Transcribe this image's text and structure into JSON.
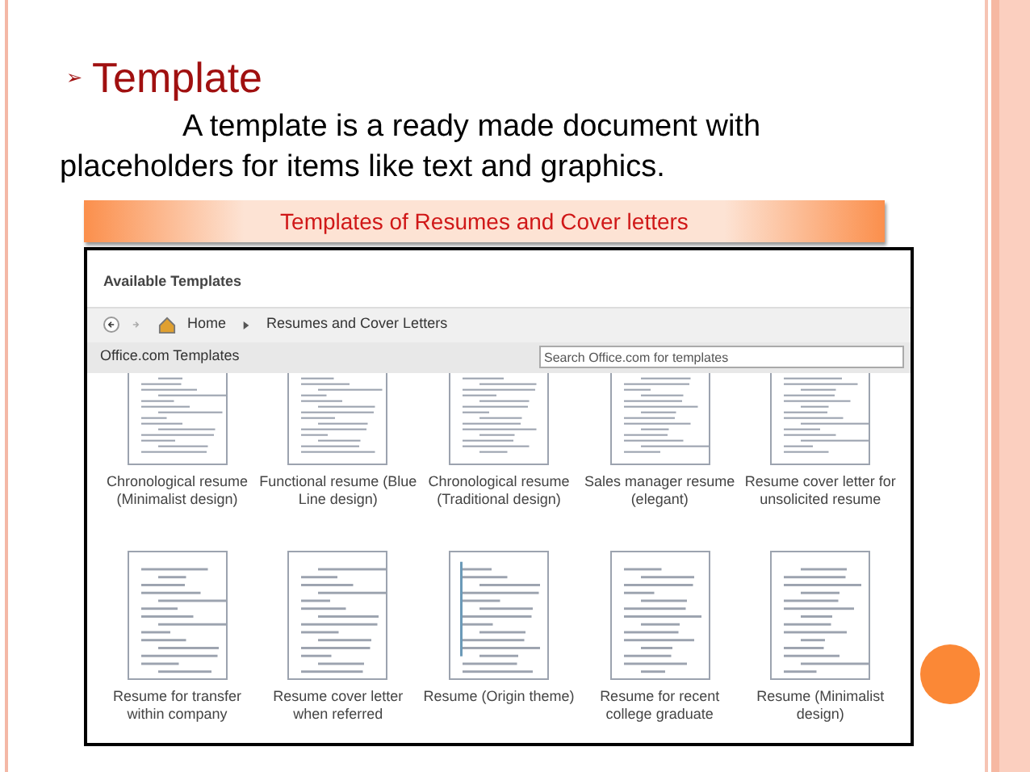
{
  "slide": {
    "bullet": "➢",
    "title": "Template",
    "body": "A template is a ready made document with placeholders for items like text and graphics.",
    "banner": "Templates of Resumes and Cover letters"
  },
  "window": {
    "heading": "Available Templates",
    "breadcrumb": [
      "Home",
      "Resumes and Cover Letters"
    ],
    "section": "Office.com Templates",
    "search": {
      "placeholder": "Search Office.com for templates"
    }
  },
  "templates": [
    {
      "label": "Chronological resume (Minimalist design)"
    },
    {
      "label": "Functional resume (Blue Line design)"
    },
    {
      "label": "Chronological resume (Traditional design)"
    },
    {
      "label": "Sales manager resume (elegant)"
    },
    {
      "label": "Resume cover letter for unsolicited resume"
    },
    {
      "label": "Resume for transfer within company"
    },
    {
      "label": "Resume cover letter when referred"
    },
    {
      "label": "Resume (Origin theme)"
    },
    {
      "label": "Resume for recent college graduate"
    },
    {
      "label": "Resume (Minimalist design)"
    }
  ]
}
